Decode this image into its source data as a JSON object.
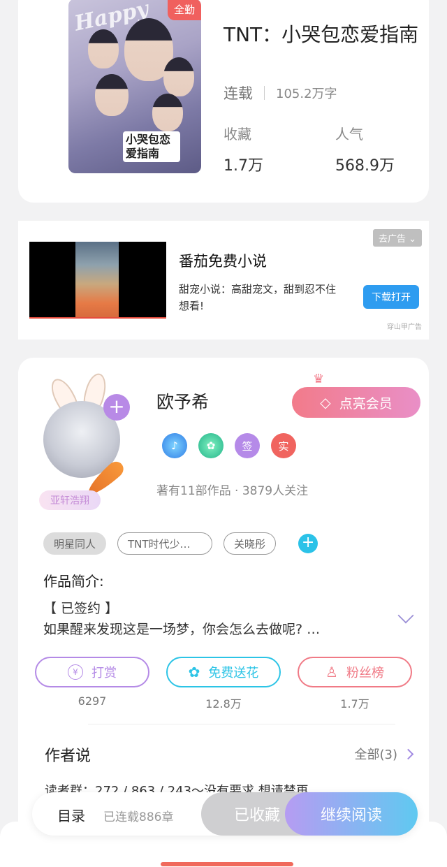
{
  "book": {
    "cover_badge": "全勤",
    "cover_title": "小哭包恋爱指南",
    "cover_deco": "Happy",
    "title": "TNT：小哭包恋爱指南",
    "status": "连载",
    "word_count": "105.2万字",
    "collect_label": "收藏",
    "collect_value": "1.7万",
    "popularity_label": "人气",
    "popularity_value": "568.9万"
  },
  "ad": {
    "close_label": "去广告",
    "title": "番茄免费小说",
    "description": "甜宠小说：高甜宠文，甜到忍不住想看!",
    "button_label": "下载打开",
    "source": "穿山甲广告"
  },
  "author": {
    "name": "欧予希",
    "fan_tag": "亚轩浩翔",
    "vip_button": "点亮会员",
    "badges": [
      "♪",
      "✿",
      "签",
      "实"
    ],
    "works_info": "著有11部作品 · 3879人关注",
    "tags": [
      "明星同人",
      "TNT时代少…",
      "关晓彤"
    ],
    "intro_title": "作品简介:",
    "intro_line1": "【 已签约 】",
    "intro_line2": "如果醒来发现这是一场梦，你会怎么去做呢? …",
    "actions": [
      {
        "label": "打赏",
        "icon": "¥",
        "count": "6297",
        "color": "#b48ae6"
      },
      {
        "label": "免费送花",
        "icon": "✿",
        "count": "12.8万",
        "color": "#2cc4e6"
      },
      {
        "label": "粉丝榜",
        "icon": "♙",
        "count": "1.7万",
        "color": "#f07a86"
      }
    ],
    "say_title": "作者说",
    "say_all": "全部(3)",
    "say_text": "读者群：272 / 863 / 243～没有要求,想请禁再…"
  },
  "bottom_bar": {
    "toc_label": "目录",
    "chapters": "已连载886章",
    "fav_label": "已收藏",
    "read_label": "继续阅读"
  },
  "colors": {
    "accent_purple": "#b48ae6",
    "accent_cyan": "#2cc4e6",
    "accent_pink": "#f07a86",
    "badge_red": "#f0605e"
  }
}
